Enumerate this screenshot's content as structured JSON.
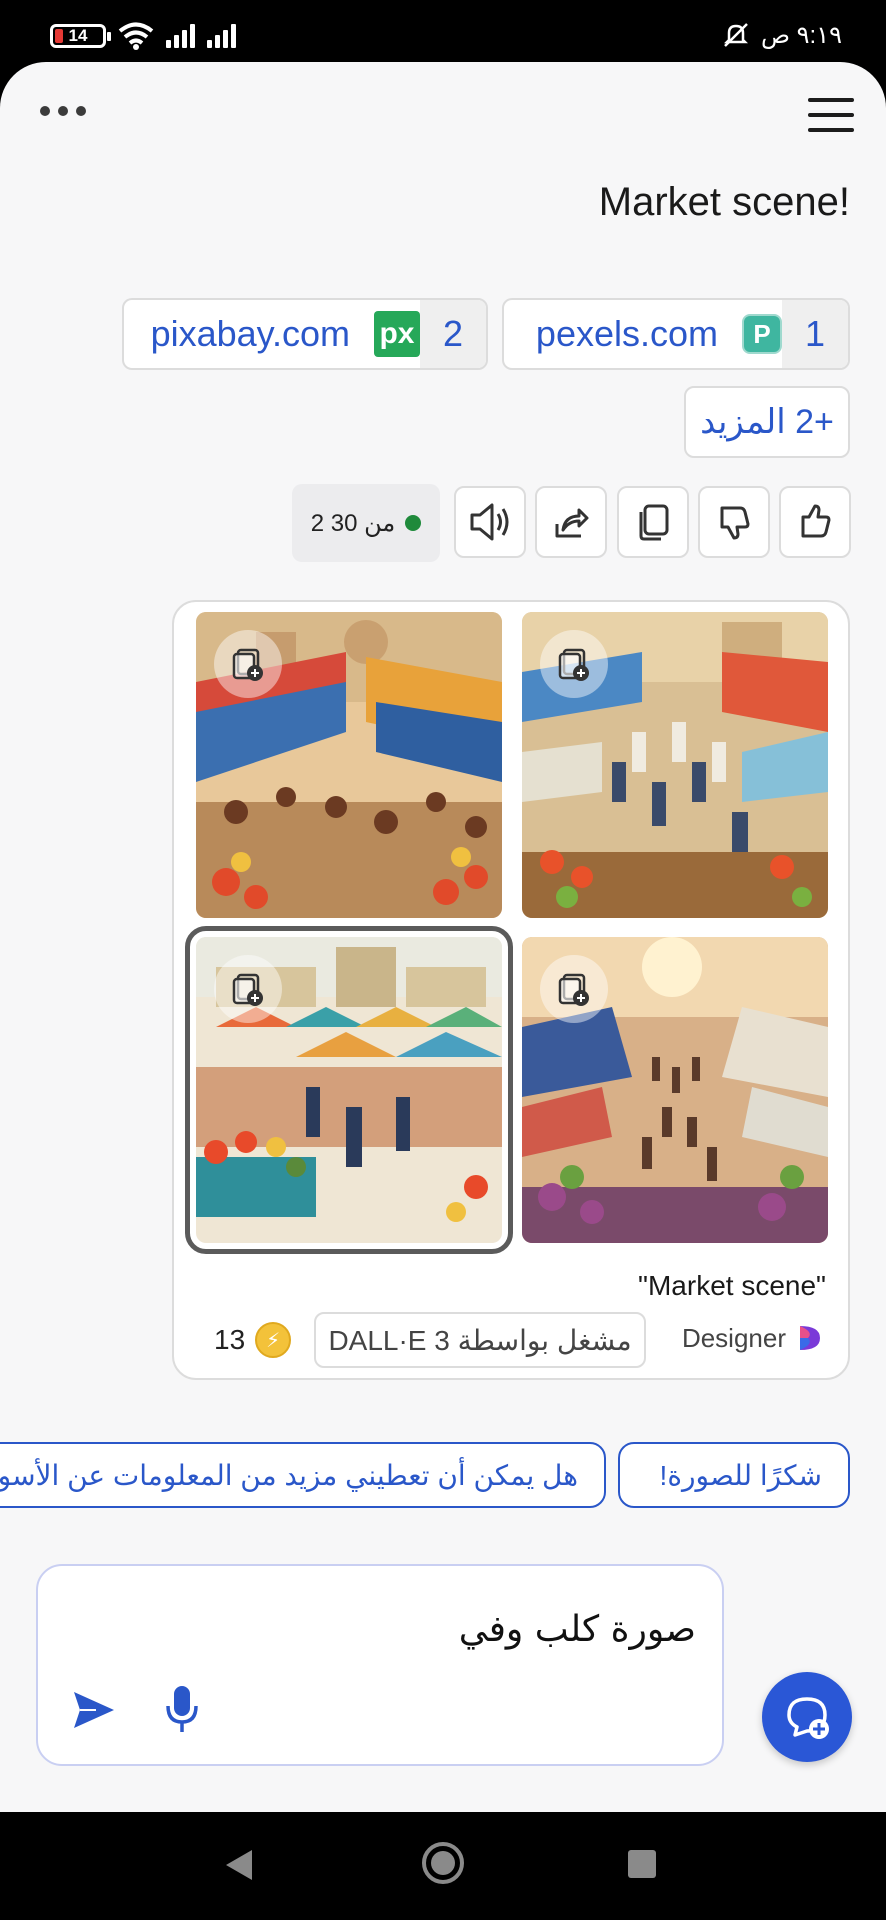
{
  "status_bar": {
    "battery": "14",
    "time": "٩:١٩ ص"
  },
  "chat": {
    "user_message": "Market scene!",
    "sources": [
      {
        "num": "1",
        "site": "pexels.com",
        "logo": "P"
      },
      {
        "num": "2",
        "site": "pixabay.com",
        "logo": "px"
      }
    ],
    "more_sources": "+2 المزيد",
    "counter": "2 من 30",
    "image_card": {
      "caption": "\"Market scene\"",
      "powered_by": "مشغل بواسطة DALL·E 3",
      "designer": "Designer",
      "credits": "13"
    },
    "suggestions": [
      "شكرًا للصورة!",
      "هل يمكن أن تعطيني مزيد من المعلومات عن الأسواق؟"
    ]
  },
  "composer": {
    "value": "صورة كلب وفي"
  },
  "colors": {
    "accent": "#2a57c9",
    "fab": "#2a57d6",
    "status_dot": "#1f8a3b"
  }
}
